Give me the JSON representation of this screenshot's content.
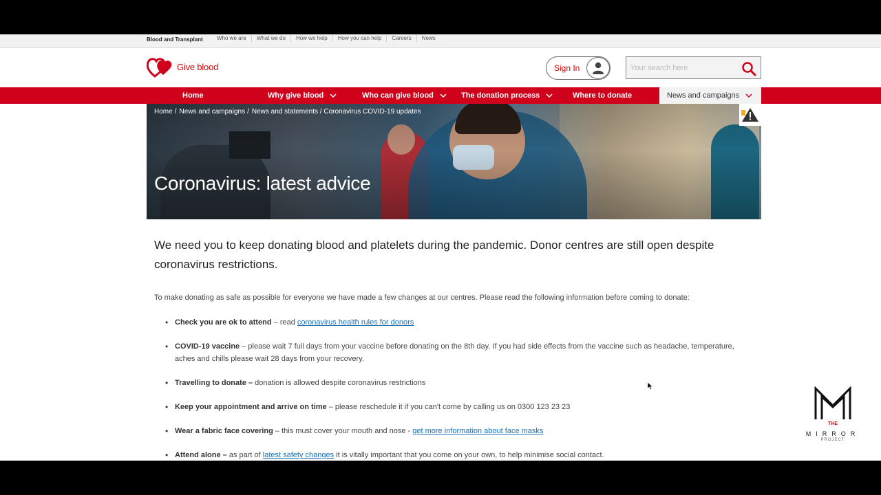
{
  "topbar": {
    "brand": "Blood and Transplant",
    "links": [
      "Who we are",
      "What we do",
      "How we help",
      "How you can help",
      "Careers",
      "News"
    ]
  },
  "header": {
    "logo_text": "Give blood",
    "sign_in": "Sign In",
    "search_placeholder": "Your search here"
  },
  "nav": {
    "items": [
      "Home",
      "Why give blood",
      "Who can give blood",
      "The donation process",
      "Where to donate",
      "News and campaigns"
    ]
  },
  "breadcrumb": [
    "Home",
    "News and campaigns",
    "News and statements / Coronavirus COVID-19 updates"
  ],
  "hero_title": "Coronavirus: latest advice",
  "lead": "We need you to keep donating blood and platelets during the pandemic. Donor centres are still open despite coronavirus restrictions.",
  "intro": "To make donating as safe as possible for everyone we have made a few changes at our centres. Please read the following information before coming to donate:",
  "points": [
    {
      "bold": "Check you are ok to attend",
      "text": " – read ",
      "link": "coronavirus health rules for donors",
      "after": ""
    },
    {
      "bold": "COVID-19 vaccine",
      "text": " – please wait 7 full days from your vaccine before donating on the 8th day. If you had side effects from the vaccine such as headache, temperature, aches and chills please wait 28 days from your recovery.",
      "link": "",
      "after": ""
    },
    {
      "bold": "Travelling to donate –",
      "text": " donation is allowed despite coronavirus restrictions",
      "link": "",
      "after": ""
    },
    {
      "bold": "Keep your appointment and arrive on time",
      "text": " – please reschedule it if you can't come by calling us on 0300 123 23 23",
      "link": "",
      "after": ""
    },
    {
      "bold": "Wear a fabric face covering",
      "text": " – this must cover your mouth and nose - ",
      "link": "get more information about face masks",
      "after": ""
    },
    {
      "bold": "Attend alone –",
      "text": " as part of ",
      "link": "latest safety changes",
      "after": " it is vitally important that you come on your own, to help minimise social contact."
    }
  ],
  "watermark": {
    "the": "THE",
    "mirror": "MIRROR",
    "project": "PROJECT"
  },
  "colors": {
    "brand_red": "#d0021b",
    "link_blue": "#1a6fb5"
  }
}
